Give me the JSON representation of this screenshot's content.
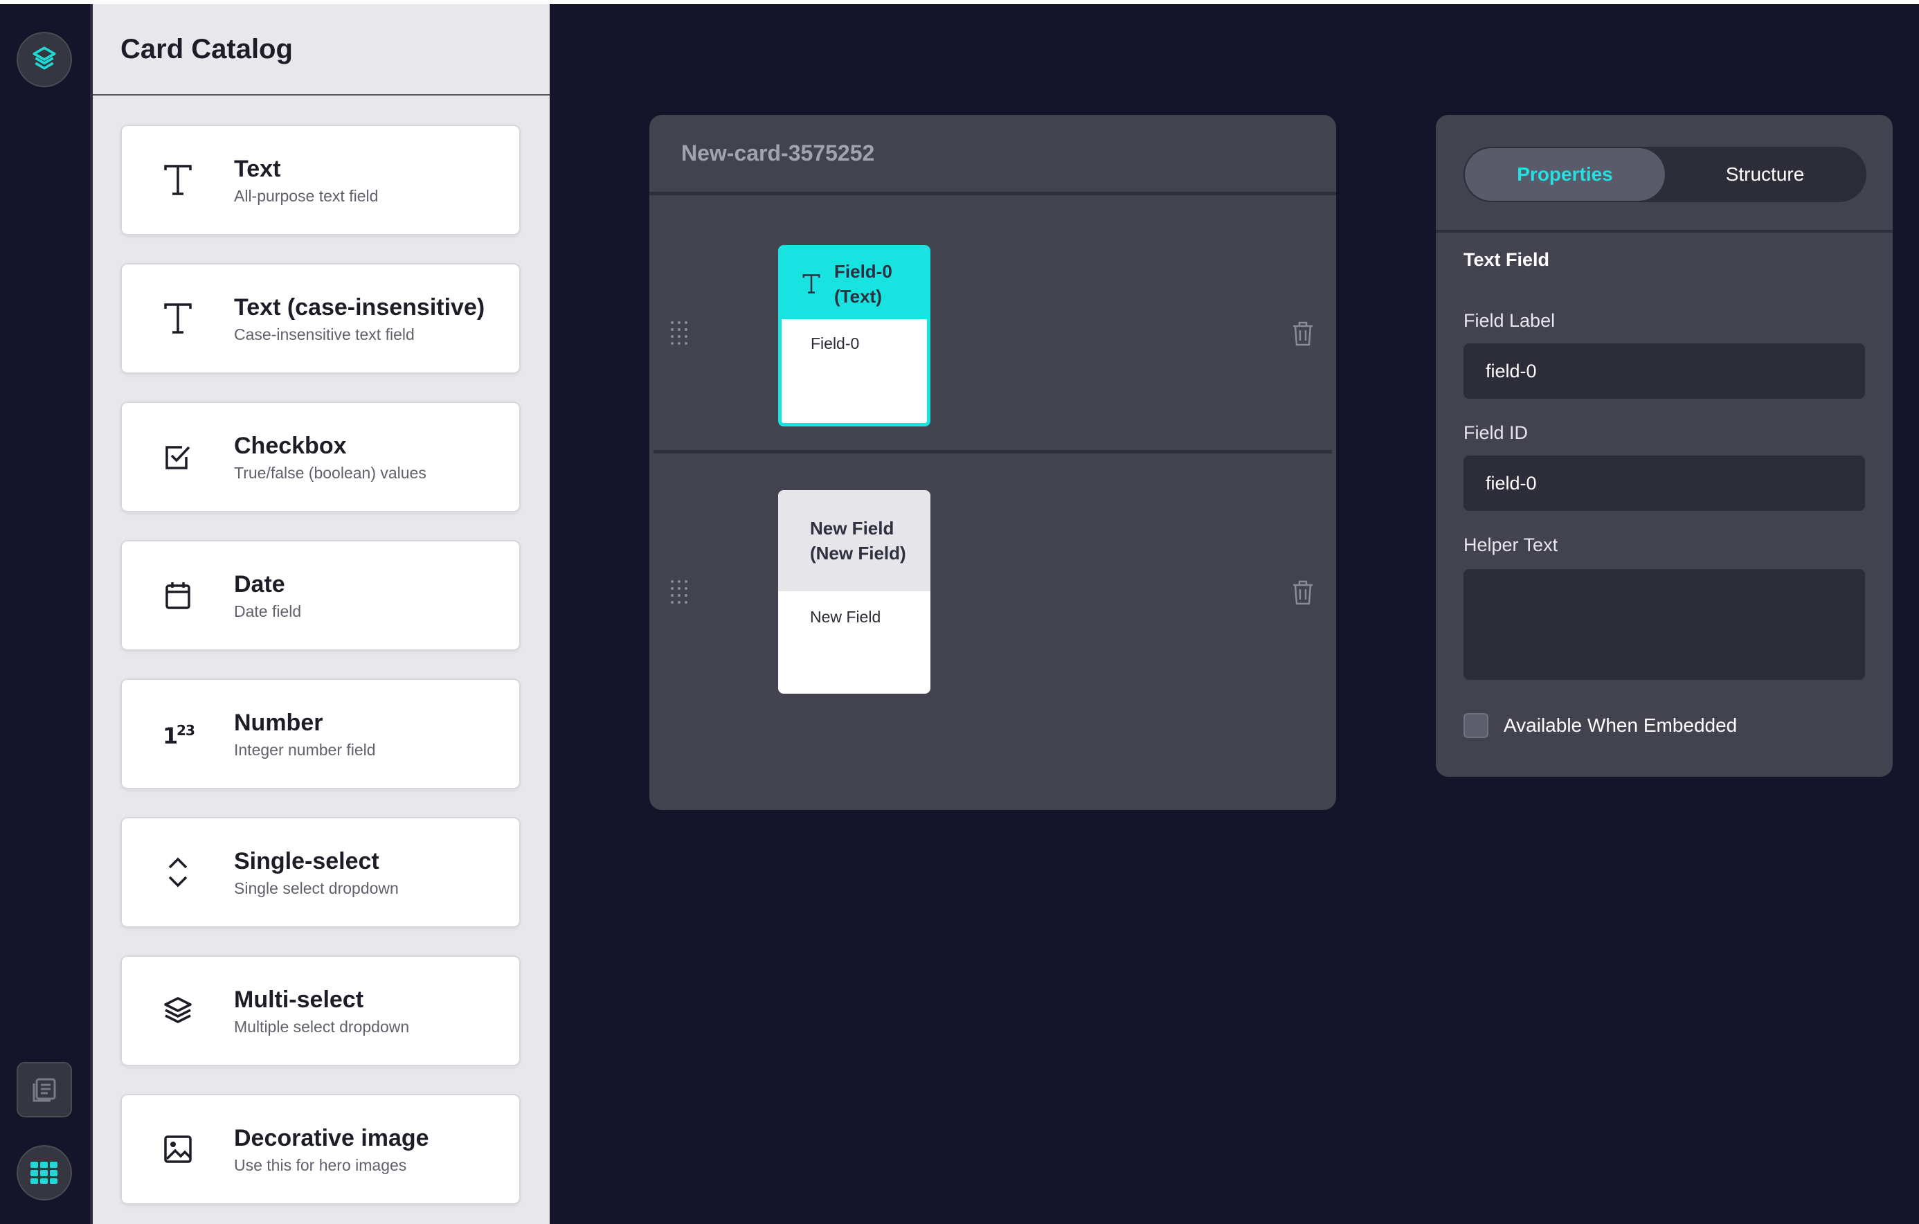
{
  "catalog": {
    "title": "Card Catalog",
    "items": [
      {
        "name": "Text",
        "description": "All-purpose text field",
        "icon": "text-t-icon"
      },
      {
        "name": "Text (case-insensitive)",
        "description": "Case-insensitive text field",
        "icon": "text-t-icon"
      },
      {
        "name": "Checkbox",
        "description": "True/false (boolean) values",
        "icon": "checkbox-icon"
      },
      {
        "name": "Date",
        "description": "Date field",
        "icon": "calendar-icon"
      },
      {
        "name": "Number",
        "description": "Integer number field",
        "icon": "number-123-icon"
      },
      {
        "name": "Single-select",
        "description": "Single select dropdown",
        "icon": "chevron-up-down-icon"
      },
      {
        "name": "Multi-select",
        "description": "Multiple select dropdown",
        "icon": "layers-icon"
      },
      {
        "name": "Decorative image",
        "description": "Use this for hero images",
        "icon": "image-icon"
      }
    ]
  },
  "card": {
    "title": "New-card-3575252",
    "fields": [
      {
        "header": "Field-0 (Text)",
        "value": "Field-0",
        "selected": true
      },
      {
        "header": "New Field (New Field)",
        "value": "New Field",
        "selected": false
      }
    ]
  },
  "props": {
    "tabs": [
      "Properties",
      "Structure"
    ],
    "active_tab": "Properties",
    "section_title": "Text Field",
    "field_label_label": "Field Label",
    "field_label_value": "field-0",
    "field_id_label": "Field ID",
    "field_id_value": "field-0",
    "helper_text_label": "Helper Text",
    "helper_text_value": "",
    "embedded_label": "Available When Embedded",
    "embedded_checked": false
  },
  "colors": {
    "background": "#14152a",
    "accent": "#18e3e1",
    "panel": "#42434e",
    "catalog_bg": "#e8e8ec"
  }
}
